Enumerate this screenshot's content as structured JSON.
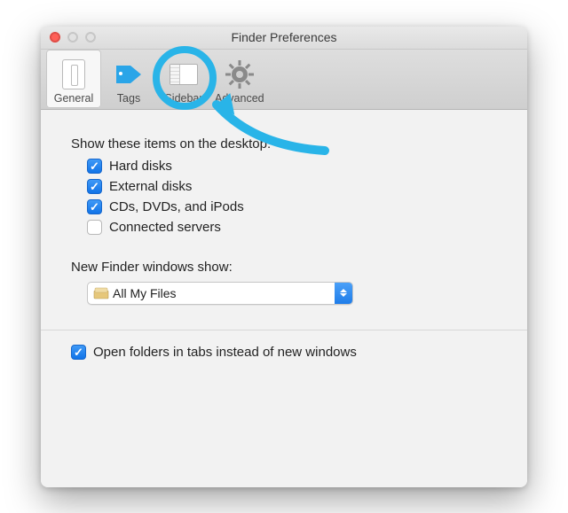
{
  "window": {
    "title": "Finder Preferences"
  },
  "toolbar": {
    "items": [
      {
        "label": "General",
        "icon": "general-icon",
        "selected": true
      },
      {
        "label": "Tags",
        "icon": "tag-icon",
        "selected": false
      },
      {
        "label": "Sidebar",
        "icon": "sidebar-icon",
        "selected": false
      },
      {
        "label": "Advanced",
        "icon": "gear-icon",
        "selected": false
      }
    ]
  },
  "general": {
    "desktop_items_label": "Show these items on the desktop:",
    "items": [
      {
        "label": "Hard disks",
        "checked": true
      },
      {
        "label": "External disks",
        "checked": true
      },
      {
        "label": "CDs, DVDs, and iPods",
        "checked": true
      },
      {
        "label": "Connected servers",
        "checked": false
      }
    ],
    "new_windows_label": "New Finder windows show:",
    "new_windows_value": "All My Files",
    "open_in_tabs": {
      "label": "Open folders in tabs instead of new windows",
      "checked": true
    }
  },
  "annotation": {
    "highlight_color": "#29b4e8",
    "highlighted_tab": "Sidebar"
  }
}
